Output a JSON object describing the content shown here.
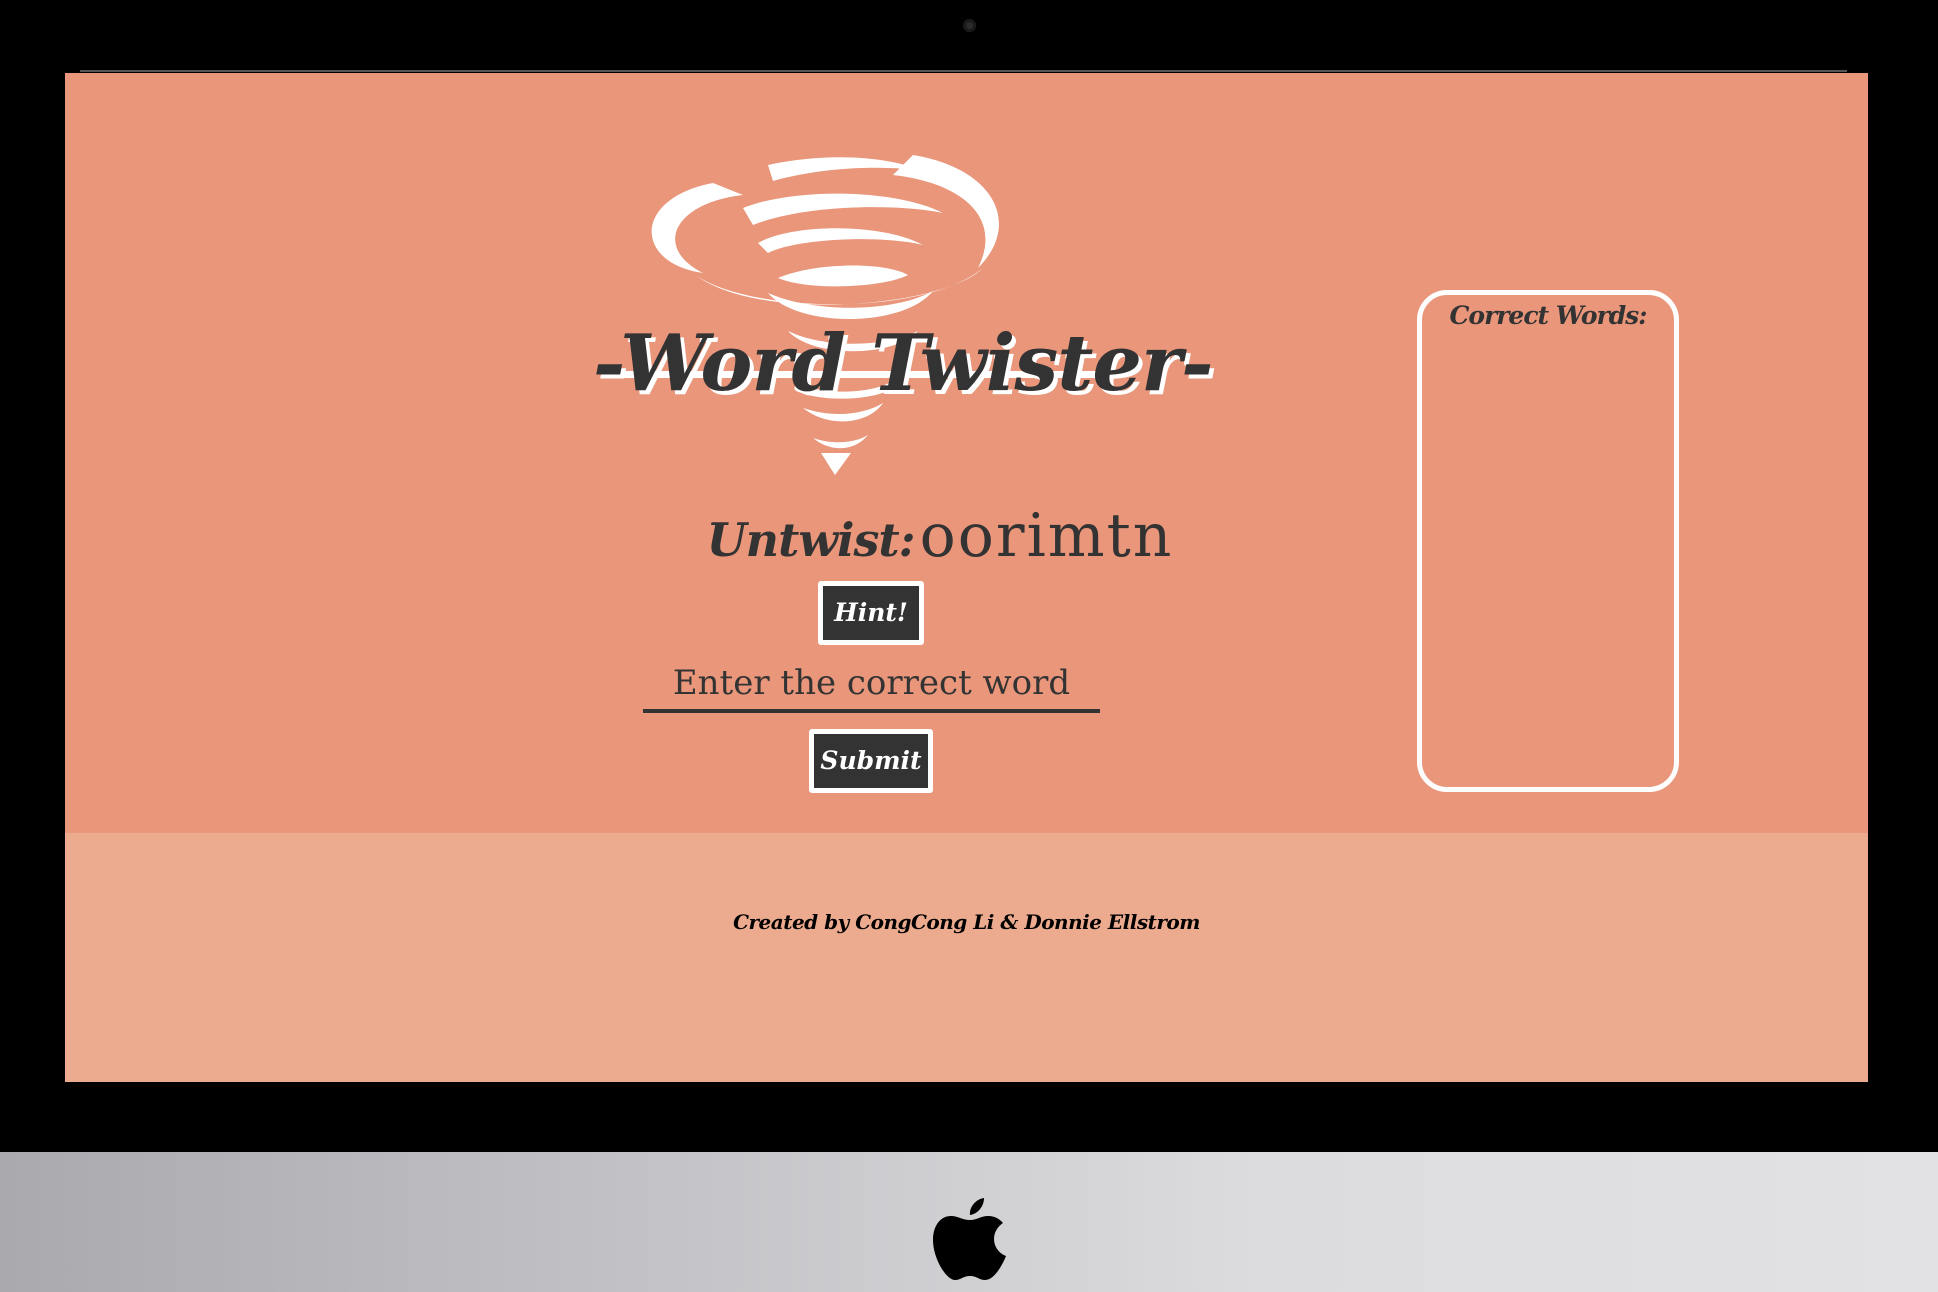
{
  "app": {
    "title": "-Word Twister-"
  },
  "colors": {
    "main_background": "#e9967a",
    "footer_background": "#ecab8f",
    "text_dark": "#333333",
    "button_background": "#333333",
    "accent_white": "#ffffff"
  },
  "game": {
    "untwist_label": "Untwist:",
    "scrambled_word": "oorimtn",
    "hint_label": "Hint!",
    "input_placeholder": "Enter the correct word",
    "input_value": "",
    "submit_label": "Submit"
  },
  "sidebar": {
    "title": "Correct Words:",
    "words": []
  },
  "footer": {
    "credits": "Created by CongCong Li & Donnie Ellstrom"
  },
  "icons": {
    "logo": "tornado-icon",
    "device": "apple-logo-icon"
  }
}
